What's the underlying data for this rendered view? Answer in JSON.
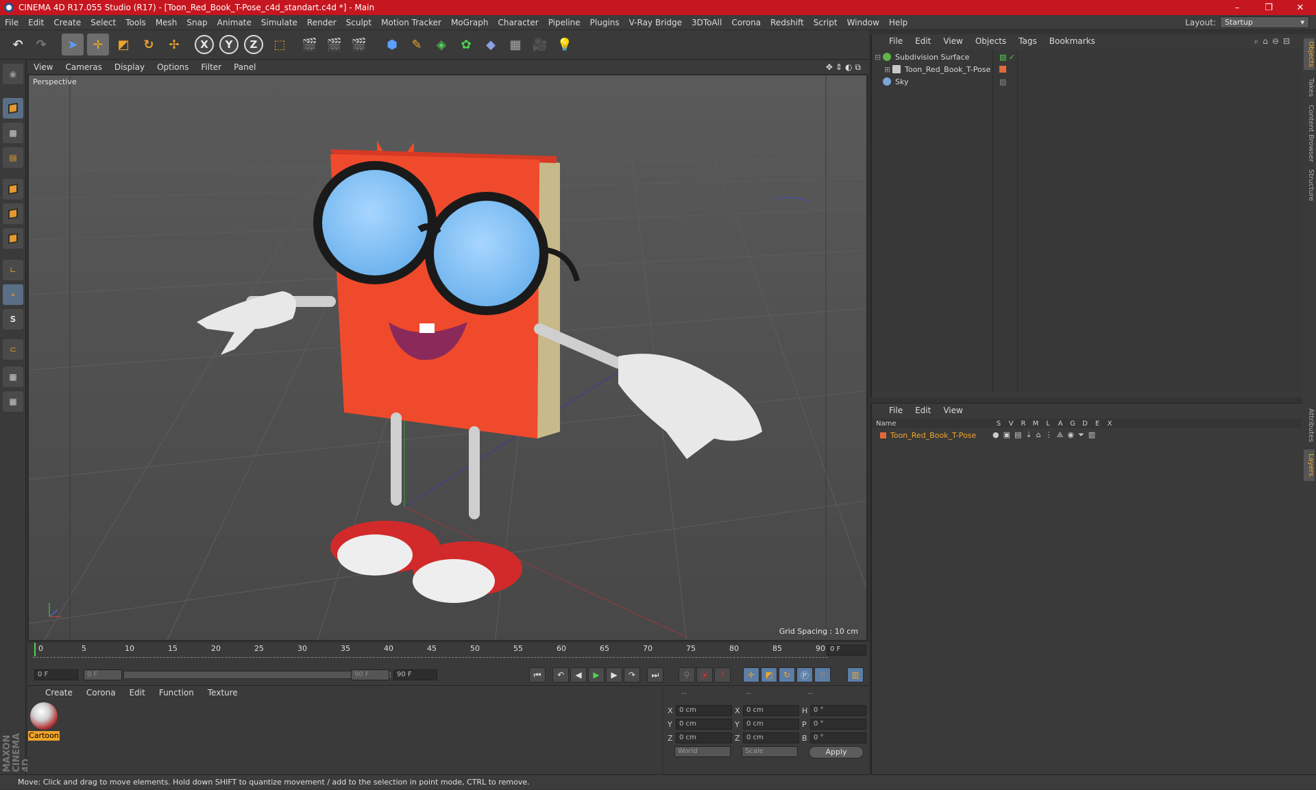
{
  "window": {
    "title": "CINEMA 4D R17.055 Studio (R17) - [Toon_Red_Book_T-Pose_c4d_standart.c4d *] - Main",
    "minimize": "–",
    "restore": "❐",
    "close": "✕"
  },
  "menubar": {
    "items": [
      "File",
      "Edit",
      "Create",
      "Select",
      "Tools",
      "Mesh",
      "Snap",
      "Animate",
      "Simulate",
      "Render",
      "Sculpt",
      "Motion Tracker",
      "MoGraph",
      "Character",
      "Pipeline",
      "Plugins",
      "V-Ray Bridge",
      "3DToAll",
      "Corona",
      "Redshift",
      "Script",
      "Window",
      "Help"
    ],
    "layout_label": "Layout:",
    "layout_value": "Startup"
  },
  "toolbar": {
    "axis_x": "X",
    "axis_y": "Y",
    "axis_z": "Z"
  },
  "viewport": {
    "menu": [
      "View",
      "Cameras",
      "Display",
      "Options",
      "Filter",
      "Panel"
    ],
    "label": "Perspective",
    "grid_spacing": "Grid Spacing : 10 cm"
  },
  "timeline": {
    "ticks": [
      "0",
      "5",
      "10",
      "15",
      "20",
      "25",
      "30",
      "35",
      "40",
      "45",
      "50",
      "55",
      "60",
      "65",
      "70",
      "75",
      "80",
      "85",
      "90"
    ],
    "current_frame": "0 F"
  },
  "transport": {
    "start_frame": "0 F",
    "range_start": "0 F",
    "range_end": "90 F",
    "end_frame": "90 F"
  },
  "materials": {
    "menu": [
      "Create",
      "Corona",
      "Edit",
      "Function",
      "Texture"
    ],
    "items": [
      {
        "name": "Cartoon"
      }
    ]
  },
  "coords": {
    "header": [
      "--",
      "--",
      "--"
    ],
    "rows": [
      {
        "l1": "X",
        "v1": "0 cm",
        "l2": "X",
        "v2": "0 cm",
        "l3": "H",
        "v3": "0 °"
      },
      {
        "l1": "Y",
        "v1": "0 cm",
        "l2": "Y",
        "v2": "0 cm",
        "l3": "P",
        "v3": "0 °"
      },
      {
        "l1": "Z",
        "v1": "0 cm",
        "l2": "Z",
        "v2": "0 cm",
        "l3": "B",
        "v3": "0 °"
      }
    ],
    "mode1": "World",
    "mode2": "Scale",
    "apply": "Apply"
  },
  "object_manager": {
    "menu": [
      "File",
      "Edit",
      "View",
      "Objects",
      "Tags",
      "Bookmarks"
    ],
    "objects": [
      {
        "name": "Subdivision Surface",
        "color": "#5fb34a"
      },
      {
        "name": "Toon_Red_Book_T-Pose",
        "color": "#c8c8c8"
      },
      {
        "name": "Sky",
        "color": "#7aa6d8"
      }
    ]
  },
  "layer_manager": {
    "menu": [
      "File",
      "Edit",
      "View"
    ],
    "columns": [
      "Name",
      "S",
      "V",
      "R",
      "M",
      "L",
      "A",
      "G",
      "D",
      "E",
      "X"
    ],
    "layers": [
      {
        "name": "Toon_Red_Book_T-Pose",
        "color": "#e06a3a"
      }
    ]
  },
  "right_tabs": [
    "Objects",
    "Takes",
    "Content Browser",
    "Structure",
    "Attributes",
    "Layers"
  ],
  "status": {
    "text": "Move: Click and drag to move elements. Hold down SHIFT to quantize movement / add to the selection in point mode, CTRL to remove."
  },
  "maxon_logo": "MAXON CINEMA 4D",
  "colors": {
    "title_bar": "#c6161f",
    "accent": "#f0a52a",
    "viewport_bg": "#4e4e4e"
  }
}
